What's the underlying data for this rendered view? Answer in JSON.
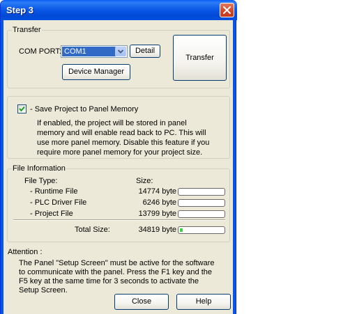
{
  "window": {
    "title": "Step 3"
  },
  "transfer_group": {
    "legend": "Transfer",
    "com_port_label": "COM PORT:",
    "com_port_value": "COM1",
    "detail_button": "Detail",
    "device_manager_button": "Device Manager",
    "transfer_button": "Transfer"
  },
  "save_group": {
    "checkbox_label": "- Save Project to Panel Memory",
    "checked": true,
    "description": "If enabled, the project will be stored in panel memory and will enable read back to PC. This will use more panel memory. Disable this feature if you require more panel memory for your project size."
  },
  "file_info": {
    "legend": "File Information",
    "file_type_header": "File Type:",
    "size_header": "Size:",
    "rows": [
      {
        "name": "- Runtime File",
        "size": "14774 byte",
        "progress": 0.0
      },
      {
        "name": "- PLC Driver File",
        "size": "6246 byte",
        "progress": 0.0
      },
      {
        "name": "- Project File",
        "size": "13799 byte",
        "progress": 0.0
      }
    ],
    "total_label": "Total Size:",
    "total_size": "34819 byte",
    "total_progress": 0.06
  },
  "attention": {
    "label": "Attention :",
    "text": "The Panel \"Setup Screen\" must be active for the software to communicate with the panel. Press the F1 key and the F5 key at the same time for 3 seconds to activate the Setup Screen."
  },
  "footer": {
    "close_button": "Close",
    "help_button": "Help"
  },
  "colors": {
    "titlebar": "#0a5ef8",
    "client_bg": "#ece9d8",
    "selection": "#316ac5",
    "progress_fill": "#37d636",
    "close_button": "#d0452a"
  },
  "icons": {
    "close": "close-icon",
    "dropdown": "chevron-down-icon",
    "check": "checkmark-icon"
  }
}
